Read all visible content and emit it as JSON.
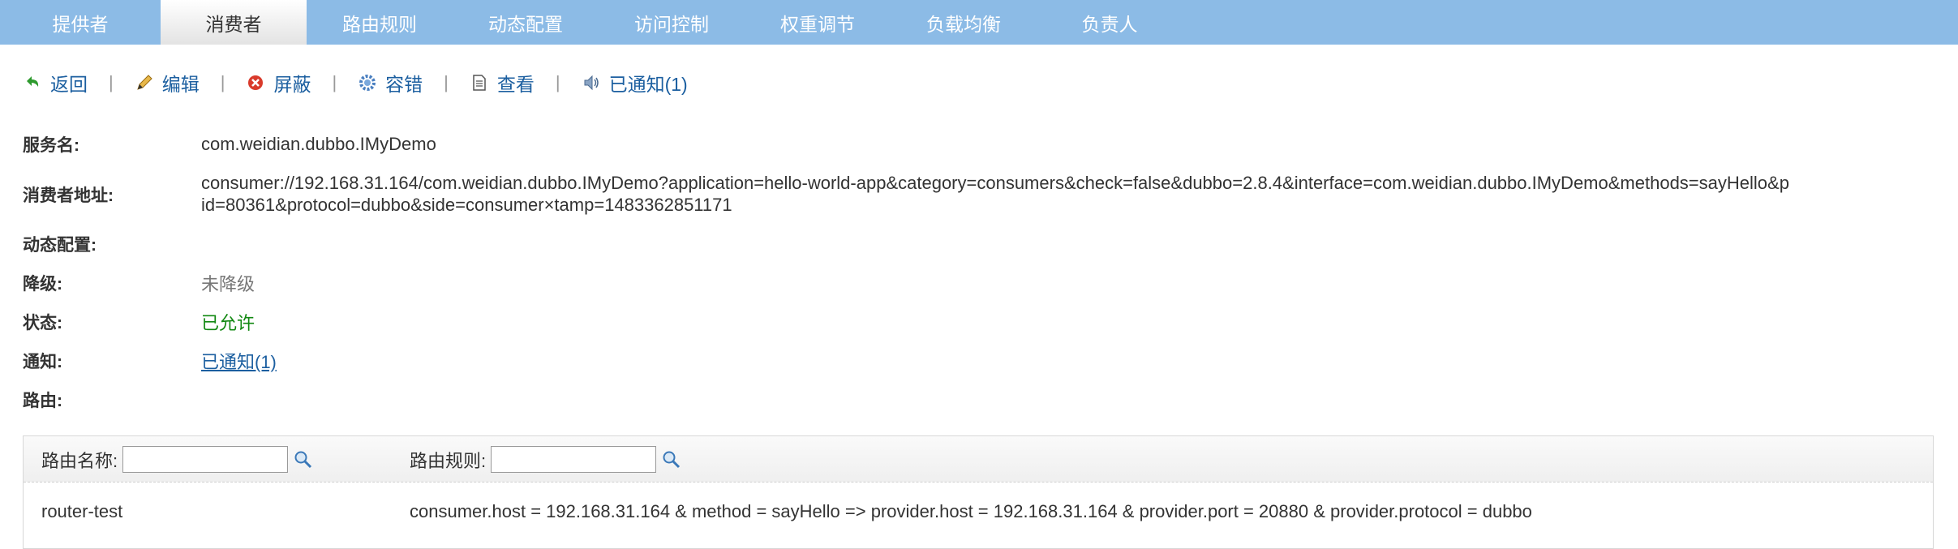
{
  "nav": {
    "tabs": [
      "提供者",
      "消费者",
      "路由规则",
      "动态配置",
      "访问控制",
      "权重调节",
      "负载均衡",
      "负责人"
    ]
  },
  "toolbar": {
    "back": "返回",
    "edit": "编辑",
    "block": "屏蔽",
    "tolerate": "容错",
    "view": "查看",
    "notified": "已通知(1)",
    "separator": "|"
  },
  "detail": {
    "service_label": "服务名:",
    "service_value": "com.weidian.dubbo.IMyDemo",
    "address_label": "消费者地址:",
    "address_line1": "consumer://192.168.31.164/com.weidian.dubbo.IMyDemo?application=hello-world-app&category=consumers&check=false&dubbo=2.8.4&interface=com.weidian.dubbo.IMyDemo&methods=sayHello&p",
    "address_line2": "id=80361&protocol=dubbo&side=consumer×tamp=1483362851171",
    "config_label": "动态配置:",
    "degrade_label": "降级:",
    "degrade_value": "未降级",
    "status_label": "状态:",
    "status_value": "已允许",
    "notify_label": "通知:",
    "notify_value": "已通知(1)",
    "route_label": "路由:"
  },
  "routes": {
    "name_filter_label": "路由名称:",
    "rule_filter_label": "路由规则:",
    "rows": [
      {
        "name": "router-test",
        "rule": "consumer.host = 192.168.31.164 & method = sayHello => provider.host = 192.168.31.164 & provider.port = 20880 & provider.protocol = dubbo"
      }
    ]
  },
  "colors": {
    "nav_bg": "#8cbbe6",
    "link": "#1c5fa0",
    "status_ok": "#118811"
  }
}
